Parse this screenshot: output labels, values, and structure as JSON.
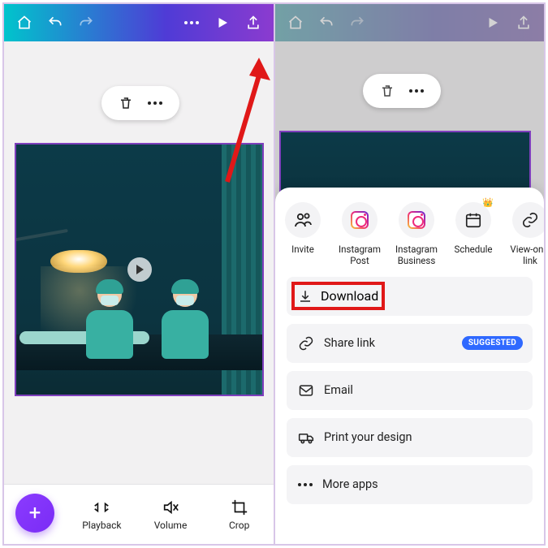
{
  "left": {
    "header": {
      "home": "home",
      "undo": "undo",
      "redo": "redo",
      "more": "more",
      "play": "play",
      "share": "share"
    },
    "toolbar": {
      "playback": "Playback",
      "volume": "Volume",
      "crop": "Crop"
    }
  },
  "right": {
    "share": {
      "items": [
        {
          "label": "Invite",
          "icon": "invite-icon"
        },
        {
          "label": "Instagram Post",
          "icon": "instagram-icon"
        },
        {
          "label": "Instagram Business",
          "icon": "instagram-icon"
        },
        {
          "label": "Schedule",
          "icon": "calendar-icon",
          "crown": true
        },
        {
          "label": "View-only link",
          "icon": "link-icon"
        }
      ]
    },
    "list": {
      "download": "Download",
      "sharelink": "Share link",
      "sharelink_badge": "SUGGESTED",
      "email": "Email",
      "print": "Print your design",
      "more": "More apps"
    }
  }
}
